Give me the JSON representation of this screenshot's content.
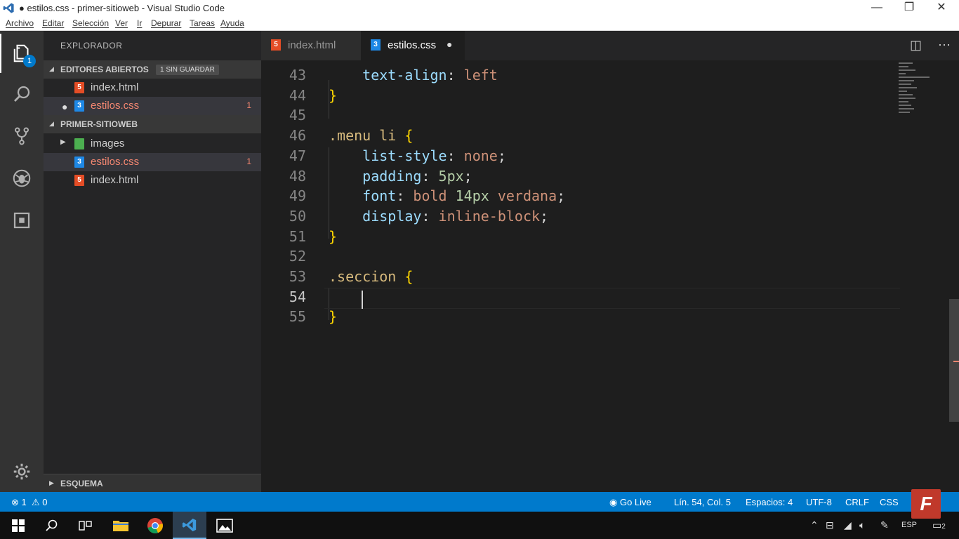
{
  "window": {
    "title": "● estilos.css - primer-sitioweb - Visual Studio Code",
    "minimize": "—",
    "maximize": "❐",
    "close": "✕"
  },
  "menu": [
    "Archivo",
    "Editar",
    "Selección",
    "Ver",
    "Ir",
    "Depurar",
    "Tareas",
    "Ayuda"
  ],
  "activity": {
    "explorer_badge": "1"
  },
  "sidebar": {
    "title": "EXPLORADOR",
    "open_editors": {
      "label": "EDITORES ABIERTOS",
      "badge": "1 SIN GUARDAR",
      "files": [
        {
          "name": "index.html",
          "type": "html",
          "dirty": false,
          "errors": ""
        },
        {
          "name": "estilos.css",
          "type": "css",
          "dirty": true,
          "errors": "1"
        }
      ]
    },
    "project": {
      "label": "PRIMER-SITIOWEB",
      "items": [
        {
          "name": "images",
          "type": "folder",
          "errors": ""
        },
        {
          "name": "estilos.css",
          "type": "css",
          "errors": "1"
        },
        {
          "name": "index.html",
          "type": "html",
          "errors": ""
        }
      ]
    },
    "outline_label": "ESQUEMA"
  },
  "tabs": [
    {
      "label": "index.html",
      "active": false
    },
    {
      "label": "estilos.css",
      "active": true,
      "modified": "●"
    }
  ],
  "editor": {
    "current_line": "54",
    "lines": [
      {
        "n": "43",
        "tokens": [
          [
            "prop",
            "    text-align"
          ],
          [
            "plain",
            ": "
          ],
          [
            "val",
            "left"
          ]
        ]
      },
      {
        "n": "44",
        "tokens": [
          [
            "brace",
            "}"
          ]
        ]
      },
      {
        "n": "45",
        "tokens": []
      },
      {
        "n": "46",
        "tokens": [
          [
            "sel-name",
            ".menu li"
          ],
          [
            "plain",
            " "
          ],
          [
            "brace",
            "{"
          ]
        ]
      },
      {
        "n": "47",
        "tokens": [
          [
            "prop",
            "    list-style"
          ],
          [
            "plain",
            ": "
          ],
          [
            "val",
            "none"
          ],
          [
            "plain",
            ";"
          ]
        ]
      },
      {
        "n": "48",
        "tokens": [
          [
            "prop",
            "    padding"
          ],
          [
            "plain",
            ": "
          ],
          [
            "num",
            "5px"
          ],
          [
            "plain",
            ";"
          ]
        ]
      },
      {
        "n": "49",
        "tokens": [
          [
            "prop",
            "    font"
          ],
          [
            "plain",
            ": "
          ],
          [
            "val",
            "bold "
          ],
          [
            "num",
            "14px"
          ],
          [
            "val",
            " verdana"
          ],
          [
            "plain",
            ";"
          ]
        ]
      },
      {
        "n": "50",
        "tokens": [
          [
            "prop",
            "    display"
          ],
          [
            "plain",
            ": "
          ],
          [
            "val",
            "inline-block"
          ],
          [
            "plain",
            ";"
          ]
        ]
      },
      {
        "n": "51",
        "tokens": [
          [
            "brace",
            "}"
          ]
        ]
      },
      {
        "n": "52",
        "tokens": []
      },
      {
        "n": "53",
        "tokens": [
          [
            "sel-name",
            ".seccion"
          ],
          [
            "plain",
            " "
          ],
          [
            "brace",
            "{"
          ]
        ]
      },
      {
        "n": "54",
        "tokens": []
      },
      {
        "n": "55",
        "tokens": [
          [
            "brace",
            "}"
          ]
        ]
      }
    ]
  },
  "status": {
    "errors": "1",
    "warnings": "0",
    "go_live": "Go Live",
    "position": "Lín. 54, Col. 5",
    "spaces": "Espacios: 4",
    "encoding": "UTF-8",
    "eol": "CRLF",
    "language": "CSS"
  },
  "tray": {
    "lang": "ESP",
    "notifications": "2"
  },
  "watermark": "F"
}
